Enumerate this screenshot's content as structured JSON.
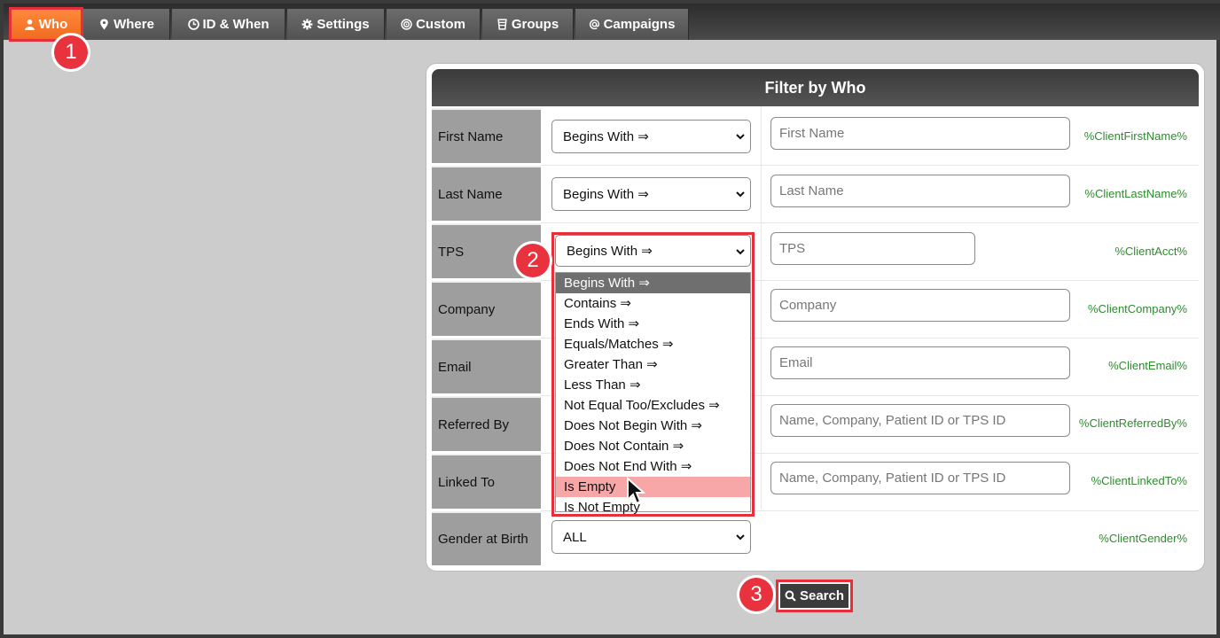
{
  "tabs": [
    {
      "label": "Who",
      "icon": "user-icon"
    },
    {
      "label": "Where",
      "icon": "map-pin-icon"
    },
    {
      "label": "ID & When",
      "icon": "clock-icon"
    },
    {
      "label": "Settings",
      "icon": "gear-icon"
    },
    {
      "label": "Custom",
      "icon": "target-icon"
    },
    {
      "label": "Groups",
      "icon": "groups-icon"
    },
    {
      "label": "Campaigns",
      "icon": "at-icon"
    }
  ],
  "badges": [
    "1",
    "2",
    "3"
  ],
  "panel": {
    "title": "Filter by Who",
    "rows": [
      {
        "label": "First Name",
        "operator": "Begins With ⇒",
        "placeholder": "First Name",
        "token": "%ClientFirstName%"
      },
      {
        "label": "Last Name",
        "operator": "Begins With ⇒",
        "placeholder": "Last Name",
        "token": "%ClientLastName%"
      },
      {
        "label": "TPS",
        "operator": "Begins With ⇒",
        "placeholder": "TPS",
        "token": "%ClientAcct%"
      },
      {
        "label": "Company",
        "operator": "",
        "placeholder": "Company",
        "token": "%ClientCompany%"
      },
      {
        "label": "Email",
        "operator": "",
        "placeholder": "Email",
        "token": "%ClientEmail%"
      },
      {
        "label": "Referred By",
        "operator": "",
        "placeholder": "Name, Company, Patient ID or TPS ID",
        "token": "%ClientReferredBy%"
      },
      {
        "label": "Linked To",
        "operator": "",
        "placeholder": "Name, Company, Patient ID or TPS ID",
        "token": "%ClientLinkedTo%"
      },
      {
        "label": "Gender at Birth",
        "operator": "ALL",
        "placeholder": "",
        "token": "%ClientGender%"
      }
    ]
  },
  "dropdown": {
    "options": [
      "Begins With ⇒",
      "Contains ⇒",
      "Ends With ⇒",
      "Equals/Matches ⇒",
      "Greater Than ⇒",
      "Less Than ⇒",
      "Not Equal Too/Excludes ⇒",
      "Does Not Begin With ⇒",
      "Does Not Contain ⇒",
      "Does Not End With ⇒",
      "Is Empty",
      "Is Not Empty"
    ],
    "selected_index": 0,
    "hover_index": 10
  },
  "search_button": {
    "label": "Search",
    "icon": "search-icon"
  },
  "colors": {
    "accent": "#f06a1e",
    "highlight": "#e5303a",
    "token": "#2e8b2e"
  }
}
